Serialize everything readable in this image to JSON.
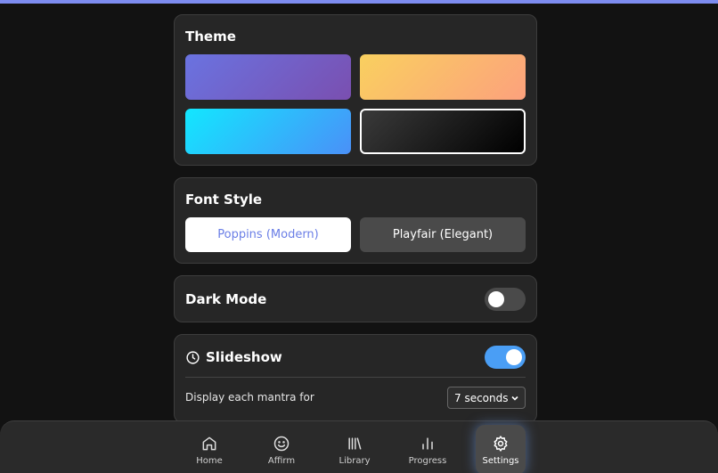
{
  "theme": {
    "title": "Theme",
    "swatch_colors": [
      "#6a73e0",
      "#f9d05f",
      "#12e7ff",
      "#000000"
    ],
    "selected_index": 3
  },
  "font_style": {
    "title": "Font Style",
    "options": [
      "Poppins (Modern)",
      "Playfair (Elegant)"
    ],
    "selected": "Poppins (Modern)"
  },
  "dark_mode": {
    "label": "Dark Mode",
    "enabled": false
  },
  "slideshow": {
    "label": "Slideshow",
    "enabled": true,
    "duration_label": "Display each mantra for",
    "duration_value": "7 seconds"
  },
  "nav": {
    "items": [
      {
        "label": "Home",
        "icon": "home-icon"
      },
      {
        "label": "Affirm",
        "icon": "smile-icon"
      },
      {
        "label": "Library",
        "icon": "library-icon"
      },
      {
        "label": "Progress",
        "icon": "bar-chart-icon"
      },
      {
        "label": "Settings",
        "icon": "gear-icon"
      }
    ],
    "active": "Settings"
  },
  "colors": {
    "accent": "#4a9ef5",
    "top_bar": "#7d8cf0"
  }
}
